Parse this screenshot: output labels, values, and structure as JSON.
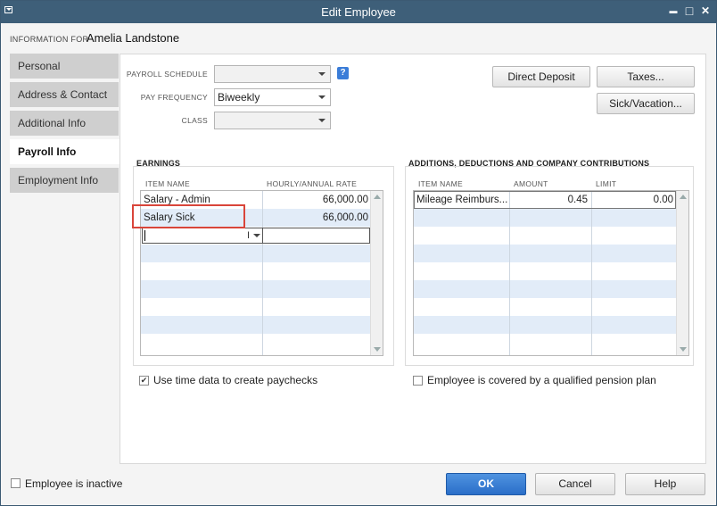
{
  "window": {
    "title": "Edit Employee",
    "minimize": "▬",
    "restore": "□",
    "close": "✕"
  },
  "info_for_label": "INFORMATION FOR",
  "employee_name": "Amelia Landstone",
  "tabs": [
    {
      "label": "Personal",
      "active": false
    },
    {
      "label": "Address & Contact",
      "active": false
    },
    {
      "label": "Additional Info",
      "active": false
    },
    {
      "label": "Payroll Info",
      "active": true
    },
    {
      "label": "Employment Info",
      "active": false
    }
  ],
  "fields": {
    "payroll_schedule": {
      "label": "PAYROLL SCHEDULE",
      "value": ""
    },
    "pay_frequency": {
      "label": "PAY FREQUENCY",
      "value": "Biweekly"
    },
    "class": {
      "label": "CLASS",
      "value": ""
    }
  },
  "help_label": "?",
  "buttons": {
    "direct_deposit": "Direct Deposit",
    "taxes": "Taxes...",
    "sick_vacation": "Sick/Vacation..."
  },
  "earnings": {
    "title": "EARNINGS",
    "columns": [
      "ITEM NAME",
      "HOURLY/ANNUAL RATE"
    ],
    "rows": [
      {
        "item": "Salary - Admin",
        "rate": "66,000.00"
      },
      {
        "item": "Salary Sick",
        "rate": "66,000.00"
      }
    ]
  },
  "additions": {
    "title": "ADDITIONS, DEDUCTIONS AND COMPANY CONTRIBUTIONS",
    "columns": [
      "ITEM NAME",
      "AMOUNT",
      "LIMIT"
    ],
    "rows": [
      {
        "item": "Mileage Reimburs...",
        "amount": "0.45",
        "limit": "0.00"
      }
    ]
  },
  "checkboxes": {
    "use_time_data": {
      "label": "Use time data to create paychecks",
      "checked": true
    },
    "pension": {
      "label": "Employee is covered by a qualified pension plan",
      "checked": false
    },
    "inactive": {
      "label": "Employee is inactive",
      "checked": false
    }
  },
  "checkmark": "✔",
  "footer": {
    "ok": "OK",
    "cancel": "Cancel",
    "help": "Help"
  }
}
